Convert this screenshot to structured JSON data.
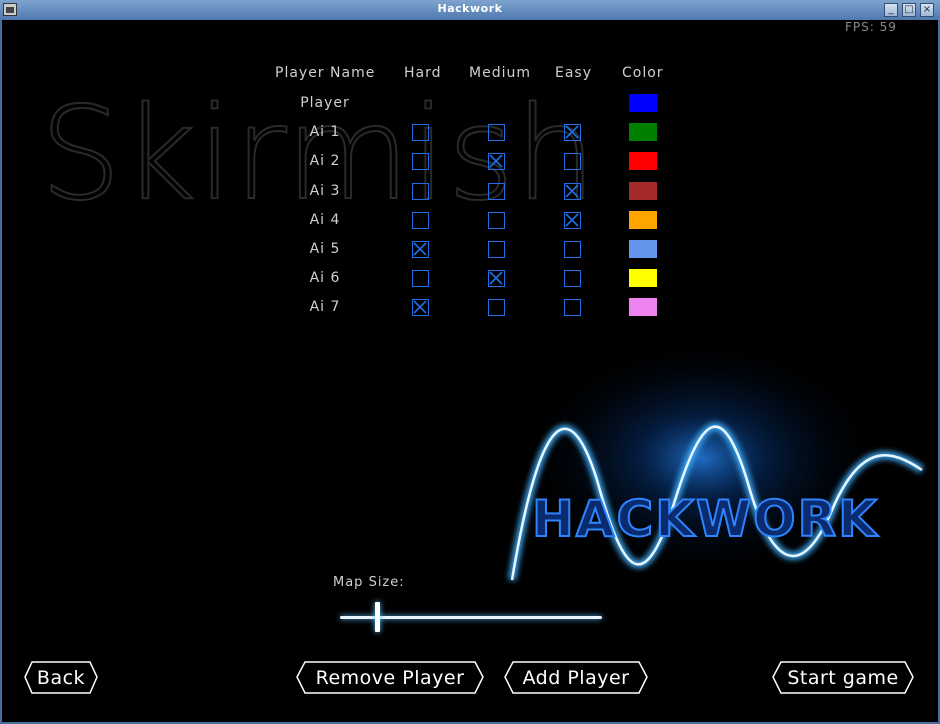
{
  "window": {
    "title": "Hackwork"
  },
  "hud": {
    "fps": "FPS: 59"
  },
  "watermark": "Skirmish",
  "table": {
    "headers": {
      "name": "Player Name",
      "hard": "Hard",
      "medium": "Medium",
      "easy": "Easy",
      "color": "Color"
    },
    "rows": [
      {
        "name": "Player",
        "difficulty": null,
        "color": "#0000ff"
      },
      {
        "name": "Ai 1",
        "difficulty": "easy",
        "color": "#008000"
      },
      {
        "name": "Ai 2",
        "difficulty": "medium",
        "color": "#ff0000"
      },
      {
        "name": "Ai 3",
        "difficulty": "easy",
        "color": "#a52a2a"
      },
      {
        "name": "Ai 4",
        "difficulty": "easy",
        "color": "#ffa500"
      },
      {
        "name": "Ai 5",
        "difficulty": "hard",
        "color": "#6495ed"
      },
      {
        "name": "Ai 6",
        "difficulty": "medium",
        "color": "#ffff00"
      },
      {
        "name": "Ai 7",
        "difficulty": "hard",
        "color": "#ee82ee"
      }
    ]
  },
  "logo": {
    "text": "HACKWORK"
  },
  "map": {
    "label": "Map Size:",
    "value_fraction": 0.14
  },
  "buttons": {
    "back": "Back",
    "remove": "Remove Player",
    "add": "Add Player",
    "start": "Start game"
  },
  "colors": {
    "accent": "#1f6fe6",
    "glow": "#5fc0ff"
  }
}
